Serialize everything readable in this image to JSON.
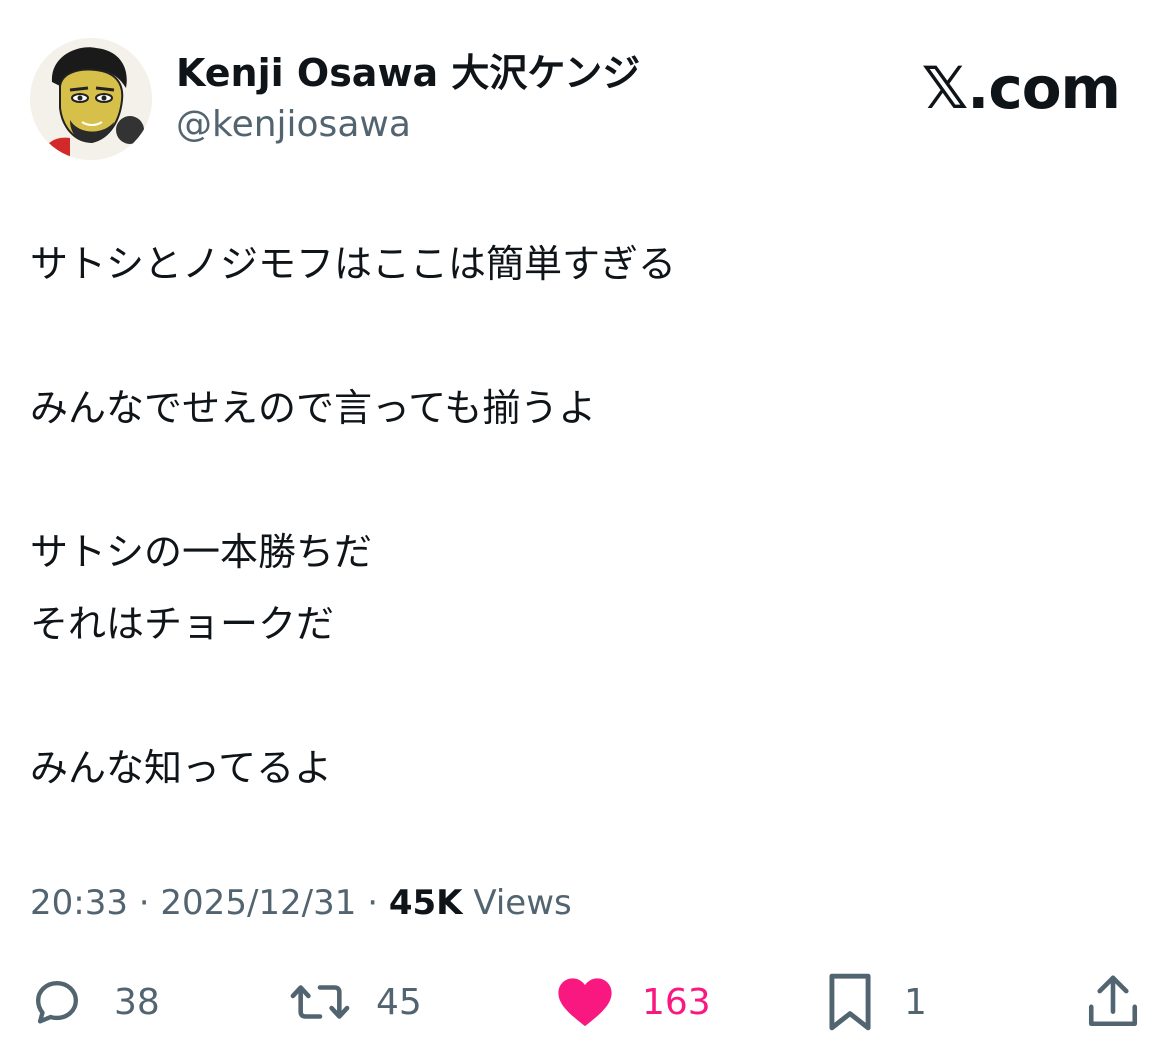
{
  "author": {
    "display_name": "Kenji Osawa 大沢ケンジ",
    "handle": "@kenjiosawa"
  },
  "brand": {
    "label": "𝕏.com"
  },
  "tweet": {
    "lines": [
      "サトシとノジモフはここは簡単すぎる",
      "",
      "みんなでせえので言っても揃うよ",
      "",
      "サトシの一本勝ちだ",
      "それはチョークだ",
      "",
      "みんな知ってるよ"
    ]
  },
  "meta": {
    "time": "20:33",
    "separator": "·",
    "date": "2025/12/31",
    "views_count": "45K",
    "views_label": "Views"
  },
  "actions": {
    "replies": "38",
    "reposts": "45",
    "likes": "163",
    "bookmarks": "1"
  },
  "colors": {
    "text_primary": "#0f1419",
    "text_secondary": "#536471",
    "like_active": "#f91880"
  },
  "icons": {
    "reply": "reply-icon",
    "repost": "repost-icon",
    "like": "heart-icon",
    "bookmark": "bookmark-icon",
    "share": "share-icon"
  }
}
